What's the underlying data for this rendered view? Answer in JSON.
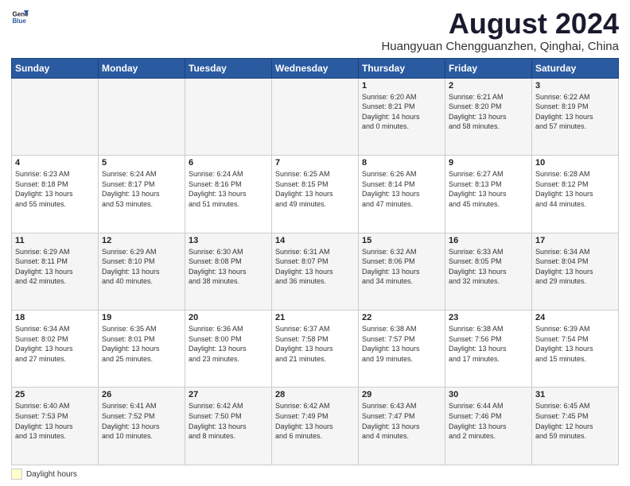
{
  "header": {
    "logo_line1": "General",
    "logo_line2": "Blue",
    "title": "August 2024",
    "subtitle": "Huangyuan Chengguanzhen, Qinghai, China"
  },
  "weekdays": [
    "Sunday",
    "Monday",
    "Tuesday",
    "Wednesday",
    "Thursday",
    "Friday",
    "Saturday"
  ],
  "weeks": [
    [
      {
        "day": "",
        "info": ""
      },
      {
        "day": "",
        "info": ""
      },
      {
        "day": "",
        "info": ""
      },
      {
        "day": "",
        "info": ""
      },
      {
        "day": "1",
        "info": "Sunrise: 6:20 AM\nSunset: 8:21 PM\nDaylight: 14 hours\nand 0 minutes."
      },
      {
        "day": "2",
        "info": "Sunrise: 6:21 AM\nSunset: 8:20 PM\nDaylight: 13 hours\nand 58 minutes."
      },
      {
        "day": "3",
        "info": "Sunrise: 6:22 AM\nSunset: 8:19 PM\nDaylight: 13 hours\nand 57 minutes."
      }
    ],
    [
      {
        "day": "4",
        "info": "Sunrise: 6:23 AM\nSunset: 8:18 PM\nDaylight: 13 hours\nand 55 minutes."
      },
      {
        "day": "5",
        "info": "Sunrise: 6:24 AM\nSunset: 8:17 PM\nDaylight: 13 hours\nand 53 minutes."
      },
      {
        "day": "6",
        "info": "Sunrise: 6:24 AM\nSunset: 8:16 PM\nDaylight: 13 hours\nand 51 minutes."
      },
      {
        "day": "7",
        "info": "Sunrise: 6:25 AM\nSunset: 8:15 PM\nDaylight: 13 hours\nand 49 minutes."
      },
      {
        "day": "8",
        "info": "Sunrise: 6:26 AM\nSunset: 8:14 PM\nDaylight: 13 hours\nand 47 minutes."
      },
      {
        "day": "9",
        "info": "Sunrise: 6:27 AM\nSunset: 8:13 PM\nDaylight: 13 hours\nand 45 minutes."
      },
      {
        "day": "10",
        "info": "Sunrise: 6:28 AM\nSunset: 8:12 PM\nDaylight: 13 hours\nand 44 minutes."
      }
    ],
    [
      {
        "day": "11",
        "info": "Sunrise: 6:29 AM\nSunset: 8:11 PM\nDaylight: 13 hours\nand 42 minutes."
      },
      {
        "day": "12",
        "info": "Sunrise: 6:29 AM\nSunset: 8:10 PM\nDaylight: 13 hours\nand 40 minutes."
      },
      {
        "day": "13",
        "info": "Sunrise: 6:30 AM\nSunset: 8:08 PM\nDaylight: 13 hours\nand 38 minutes."
      },
      {
        "day": "14",
        "info": "Sunrise: 6:31 AM\nSunset: 8:07 PM\nDaylight: 13 hours\nand 36 minutes."
      },
      {
        "day": "15",
        "info": "Sunrise: 6:32 AM\nSunset: 8:06 PM\nDaylight: 13 hours\nand 34 minutes."
      },
      {
        "day": "16",
        "info": "Sunrise: 6:33 AM\nSunset: 8:05 PM\nDaylight: 13 hours\nand 32 minutes."
      },
      {
        "day": "17",
        "info": "Sunrise: 6:34 AM\nSunset: 8:04 PM\nDaylight: 13 hours\nand 29 minutes."
      }
    ],
    [
      {
        "day": "18",
        "info": "Sunrise: 6:34 AM\nSunset: 8:02 PM\nDaylight: 13 hours\nand 27 minutes."
      },
      {
        "day": "19",
        "info": "Sunrise: 6:35 AM\nSunset: 8:01 PM\nDaylight: 13 hours\nand 25 minutes."
      },
      {
        "day": "20",
        "info": "Sunrise: 6:36 AM\nSunset: 8:00 PM\nDaylight: 13 hours\nand 23 minutes."
      },
      {
        "day": "21",
        "info": "Sunrise: 6:37 AM\nSunset: 7:58 PM\nDaylight: 13 hours\nand 21 minutes."
      },
      {
        "day": "22",
        "info": "Sunrise: 6:38 AM\nSunset: 7:57 PM\nDaylight: 13 hours\nand 19 minutes."
      },
      {
        "day": "23",
        "info": "Sunrise: 6:38 AM\nSunset: 7:56 PM\nDaylight: 13 hours\nand 17 minutes."
      },
      {
        "day": "24",
        "info": "Sunrise: 6:39 AM\nSunset: 7:54 PM\nDaylight: 13 hours\nand 15 minutes."
      }
    ],
    [
      {
        "day": "25",
        "info": "Sunrise: 6:40 AM\nSunset: 7:53 PM\nDaylight: 13 hours\nand 13 minutes."
      },
      {
        "day": "26",
        "info": "Sunrise: 6:41 AM\nSunset: 7:52 PM\nDaylight: 13 hours\nand 10 minutes."
      },
      {
        "day": "27",
        "info": "Sunrise: 6:42 AM\nSunset: 7:50 PM\nDaylight: 13 hours\nand 8 minutes."
      },
      {
        "day": "28",
        "info": "Sunrise: 6:42 AM\nSunset: 7:49 PM\nDaylight: 13 hours\nand 6 minutes."
      },
      {
        "day": "29",
        "info": "Sunrise: 6:43 AM\nSunset: 7:47 PM\nDaylight: 13 hours\nand 4 minutes."
      },
      {
        "day": "30",
        "info": "Sunrise: 6:44 AM\nSunset: 7:46 PM\nDaylight: 13 hours\nand 2 minutes."
      },
      {
        "day": "31",
        "info": "Sunrise: 6:45 AM\nSunset: 7:45 PM\nDaylight: 12 hours\nand 59 minutes."
      }
    ]
  ],
  "footer": {
    "legend_label": "Daylight hours"
  }
}
